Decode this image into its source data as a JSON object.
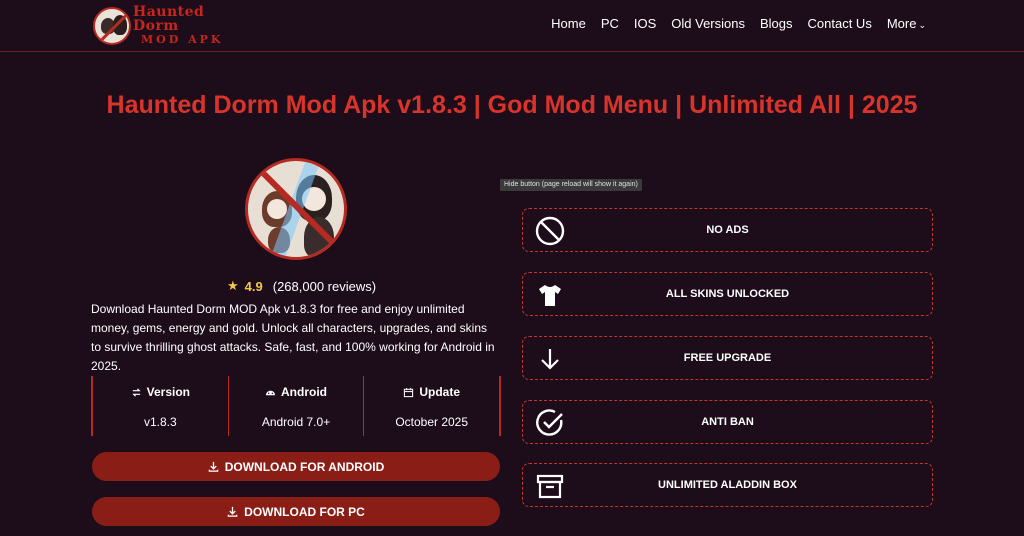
{
  "header": {
    "logo_line1": "Haunted Dorm",
    "logo_line2": "MOD APK",
    "nav": {
      "home": "Home",
      "pc": "PC",
      "ios": "IOS",
      "old_versions": "Old Versions",
      "blogs": "Blogs",
      "contact": "Contact Us",
      "more": "More"
    }
  },
  "page": {
    "title": "Haunted Dorm Mod Apk v1.8.3 | God Mod Menu | Unlimited All | 2025"
  },
  "app": {
    "rating": "4.9",
    "reviews": "(268,000 reviews)",
    "description": "Download Haunted Dorm MOD Apk v1.8.3 for free and enjoy unlimited money, gems, energy and gold. Unlock all characters, upgrades, and skins to survive thrilling ghost attacks. Safe, fast, and 100% working for Android in 2025."
  },
  "specs": {
    "version": {
      "label": "Version",
      "value": "v1.8.3"
    },
    "android": {
      "label": "Android",
      "value": "Android 7.0+"
    },
    "update": {
      "label": "Update",
      "value": "October 2025"
    }
  },
  "buttons": {
    "download_android": "DOWNLOAD FOR ANDROID",
    "download_pc": "DOWNLOAD FOR PC"
  },
  "tooltip": "Hide button (page reload will show it again)",
  "features": [
    {
      "label": "NO ADS",
      "icon": "no-entry-icon"
    },
    {
      "label": "ALL SKINS UNLOCKED",
      "icon": "tshirt-icon"
    },
    {
      "label": "FREE UPGRADE",
      "icon": "arrow-down-icon"
    },
    {
      "label": "ANTI BAN",
      "icon": "check-circle-icon"
    },
    {
      "label": "UNLIMITED ALADDIN BOX",
      "icon": "box-icon"
    }
  ],
  "colors": {
    "background": "#1d0d1a",
    "accent": "#c8261d",
    "button": "#8a1e17",
    "star": "#f2c94c"
  }
}
